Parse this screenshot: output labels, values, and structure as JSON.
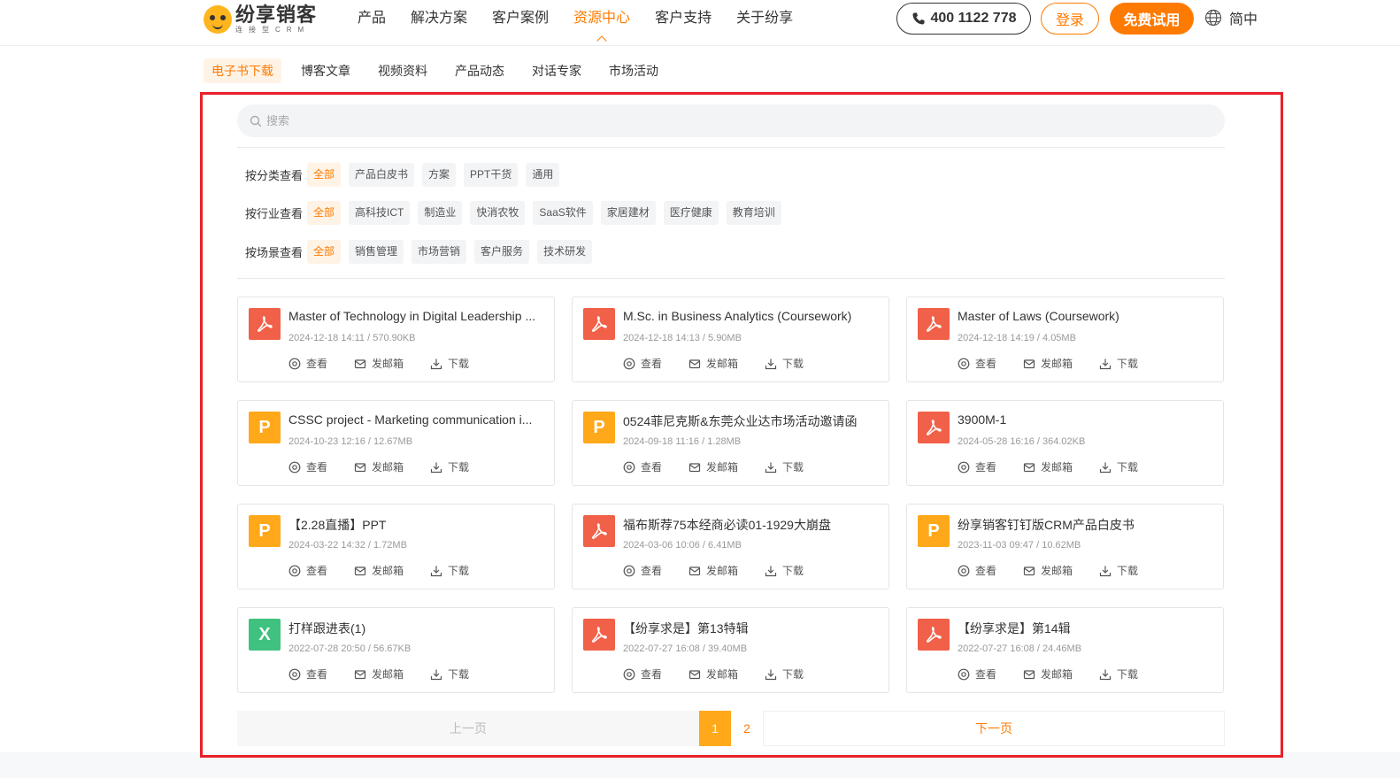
{
  "header": {
    "logo_title": "纷享销客",
    "logo_sub": "连接型CRM",
    "nav": [
      {
        "label": "产品",
        "active": false
      },
      {
        "label": "解决方案",
        "active": false
      },
      {
        "label": "客户案例",
        "active": false
      },
      {
        "label": "资源中心",
        "active": true
      },
      {
        "label": "客户支持",
        "active": false
      },
      {
        "label": "关于纷享",
        "active": false
      }
    ],
    "phone": "400 1122 778",
    "login": "登录",
    "trial": "免费试用",
    "lang": "简中"
  },
  "sub_nav": [
    {
      "label": "电子书下载",
      "active": true
    },
    {
      "label": "博客文章",
      "active": false
    },
    {
      "label": "视频资料",
      "active": false
    },
    {
      "label": "产品动态",
      "active": false
    },
    {
      "label": "对话专家",
      "active": false
    },
    {
      "label": "市场活动",
      "active": false
    }
  ],
  "search": {
    "placeholder": "搜索"
  },
  "filters": [
    {
      "label": "按分类查看",
      "chips": [
        "全部",
        "产品白皮书",
        "方案",
        "PPT干货",
        "通用"
      ],
      "active_index": 0
    },
    {
      "label": "按行业查看",
      "chips": [
        "全部",
        "高科技ICT",
        "制造业",
        "快消农牧",
        "SaaS软件",
        "家居建材",
        "医疗健康",
        "教育培训"
      ],
      "active_index": 0
    },
    {
      "label": "按场景查看",
      "chips": [
        "全部",
        "销售管理",
        "市场营销",
        "客户服务",
        "技术研发"
      ],
      "active_index": 0
    }
  ],
  "actions": {
    "view": "查看",
    "email": "发邮箱",
    "download": "下载"
  },
  "files": [
    {
      "title": "Master of Technology in Digital Leadership ...",
      "meta": "2024-12-18 14:11 / 570.90KB",
      "type": "pdf"
    },
    {
      "title": "M.Sc. in Business Analytics (Coursework)",
      "meta": "2024-12-18 14:13 / 5.90MB",
      "type": "pdf"
    },
    {
      "title": "Master of Laws (Coursework)",
      "meta": "2024-12-18 14:19 / 4.05MB",
      "type": "pdf"
    },
    {
      "title": "CSSC project - Marketing communication i...",
      "meta": "2024-10-23 12:16 / 12.67MB",
      "type": "ppt",
      "glyph": "P"
    },
    {
      "title": "0524菲尼克斯&东莞众业达市场活动邀请函",
      "meta": "2024-09-18 11:16 / 1.28MB",
      "type": "ppt",
      "glyph": "P"
    },
    {
      "title": "3900M-1",
      "meta": "2024-05-28 16:16 / 364.02KB",
      "type": "pdf"
    },
    {
      "title": "【2.28直播】PPT",
      "meta": "2024-03-22 14:32 / 1.72MB",
      "type": "ppt",
      "glyph": "P"
    },
    {
      "title": "福布斯荐75本经商必读01-1929大崩盘",
      "meta": "2024-03-06 10:06 / 6.41MB",
      "type": "pdf"
    },
    {
      "title": "纷享销客钉钉版CRM产品白皮书",
      "meta": "2023-11-03 09:47 / 10.62MB",
      "type": "ppt",
      "glyph": "P"
    },
    {
      "title": "打样跟进表(1)",
      "meta": "2022-07-28 20:50 / 56.67KB",
      "type": "xls",
      "glyph": "X"
    },
    {
      "title": "【纷享求是】第13特辑",
      "meta": "2022-07-27 16:08 / 39.40MB",
      "type": "pdf"
    },
    {
      "title": "【纷享求是】第14辑",
      "meta": "2022-07-27 16:08 / 24.46MB",
      "type": "pdf"
    }
  ],
  "pagination": {
    "prev": "上一页",
    "current": "1",
    "other": "2",
    "next": "下一页"
  },
  "colors": {
    "accent": "#ff7a00",
    "highlight": "#e8202a",
    "pdf": "#f16048",
    "ppt": "#ffa91a",
    "xls": "#3fc17f"
  }
}
